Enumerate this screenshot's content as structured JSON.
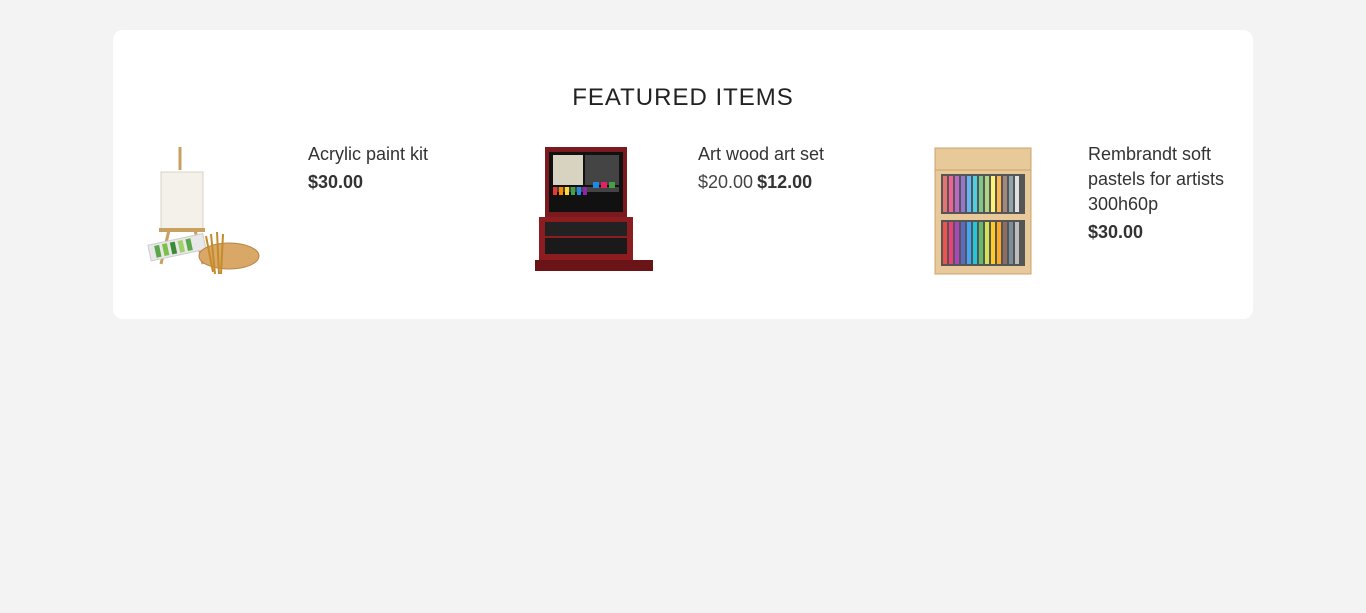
{
  "section": {
    "title": "FEATURED ITEMS"
  },
  "products": [
    {
      "name": "Acrylic paint kit",
      "price": "$30.00",
      "image_icon": "acrylic-paint-kit-image"
    },
    {
      "name": "Art wood art set",
      "old_price": "$20.00",
      "price": "$12.00",
      "image_icon": "art-wood-art-set-image"
    },
    {
      "name": "Rembrandt soft pastels for artists 300h60p",
      "price": "$30.00",
      "image_icon": "pastels-set-image"
    }
  ]
}
